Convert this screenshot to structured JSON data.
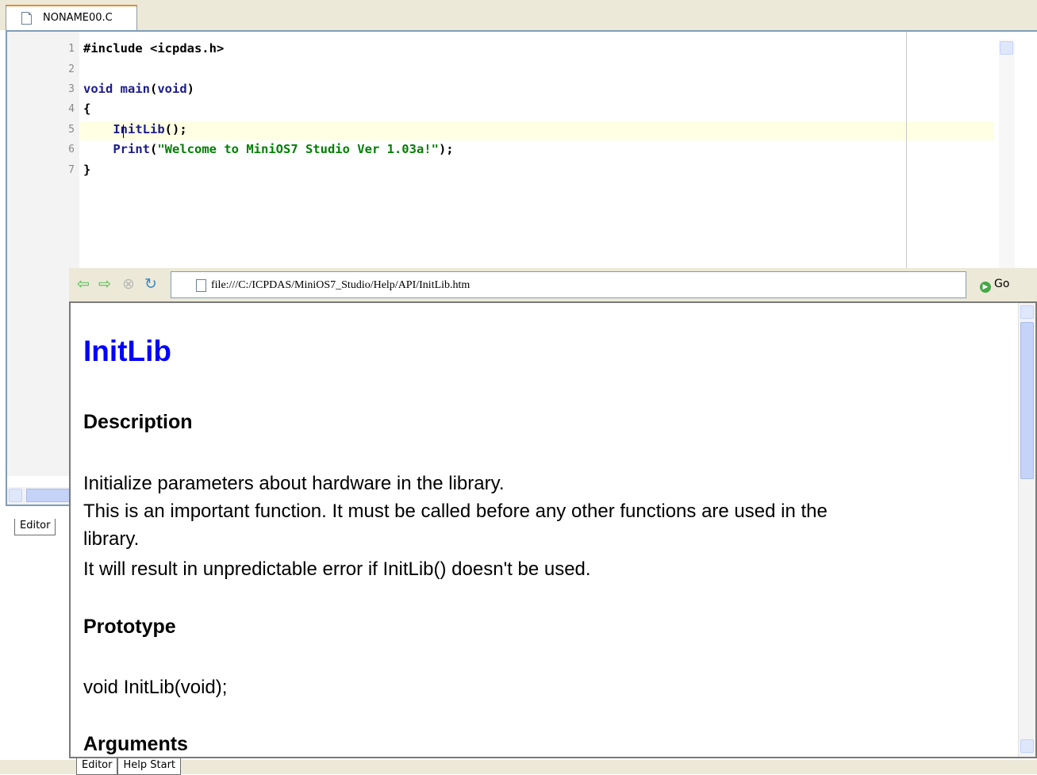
{
  "editor": {
    "tab_label": "NONAME00.C",
    "line_numbers": [
      "1",
      "2",
      "3",
      "4",
      "5",
      "6",
      "7"
    ],
    "lines": [
      {
        "parts": [
          {
            "t": "#include <icpdas.h>",
            "c": ""
          }
        ]
      },
      {
        "parts": []
      },
      {
        "parts": [
          {
            "t": "void",
            "c": "kw"
          },
          {
            "t": " ",
            "c": ""
          },
          {
            "t": "main",
            "c": "fn"
          },
          {
            "t": "(",
            "c": ""
          },
          {
            "t": "void",
            "c": "kw"
          },
          {
            "t": ")",
            "c": ""
          }
        ]
      },
      {
        "parts": [
          {
            "t": "{",
            "c": ""
          }
        ]
      },
      {
        "parts": [
          {
            "t": "    ",
            "c": ""
          },
          {
            "t": "InitLib",
            "c": "fn"
          },
          {
            "t": "();",
            "c": ""
          }
        ]
      },
      {
        "parts": [
          {
            "t": "    ",
            "c": ""
          },
          {
            "t": "Print",
            "c": "fn"
          },
          {
            "t": "(",
            "c": ""
          },
          {
            "t": "\"Welcome to MiniOS7 Studio Ver 1.03a!\"",
            "c": "str"
          },
          {
            "t": ");",
            "c": ""
          }
        ]
      },
      {
        "parts": [
          {
            "t": "}",
            "c": ""
          }
        ]
      }
    ],
    "bottom_tab": "Editor"
  },
  "help": {
    "url": "file:///C:/ICPDAS/MiniOS7_Studio/Help/API/InitLib.htm",
    "go_label": "Go",
    "title": "InitLib",
    "description_heading": "Description",
    "description_lines": [
      "Initialize parameters about hardware in the library.",
      "This is an important function. It must be called before any other functions are used in the",
      "library.",
      "It will result in unpredictable error if InitLib() doesn't be used."
    ],
    "prototype_heading": "Prototype",
    "prototype": "void InitLib(void);",
    "arguments_heading": "Arguments"
  },
  "bottom_tabs": [
    "Editor",
    "Help Start"
  ],
  "icons": {
    "back": "back-arrow-icon",
    "forward": "forward-arrow-icon",
    "stop": "stop-icon",
    "refresh": "refresh-icon",
    "go": "go-icon",
    "document": "document-icon"
  }
}
